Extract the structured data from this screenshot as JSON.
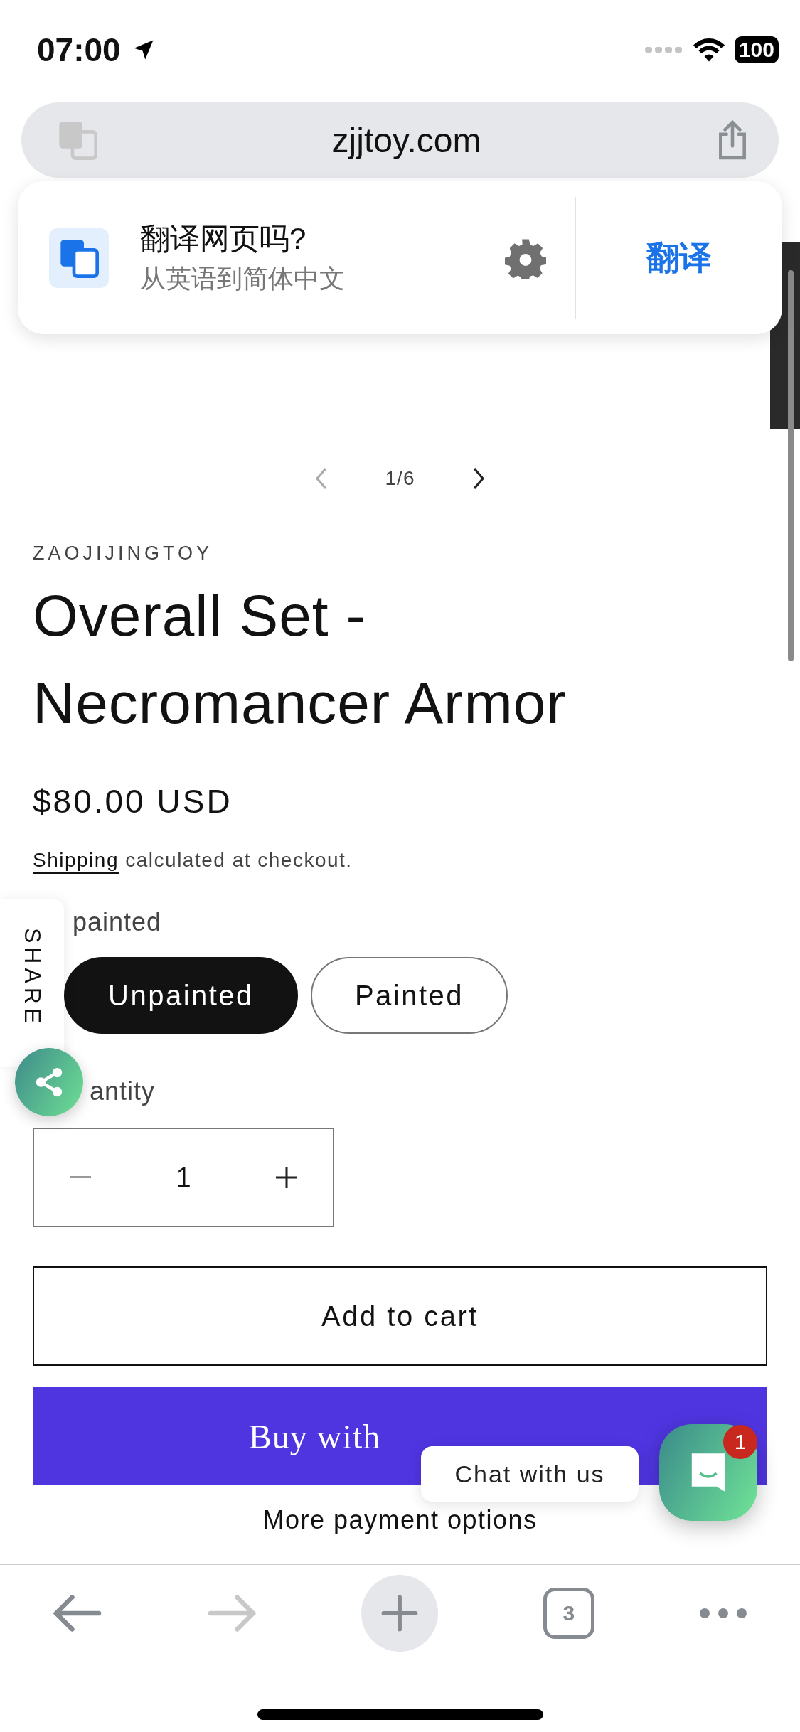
{
  "status_bar": {
    "time": "07:00",
    "battery": "100"
  },
  "address_bar": {
    "url": "zjjtoy.com"
  },
  "translate_prompt": {
    "title": "翻译网页吗?",
    "subtitle": "从英语到简体中文",
    "action": "翻译"
  },
  "gallery": {
    "counter": "1/6"
  },
  "product": {
    "vendor": "ZAOJIJINGTOY",
    "title": "Overall Set - Necromancer Armor",
    "price": "$80.00 USD",
    "shipping_link": "Shipping",
    "shipping_note": "calculated at checkout."
  },
  "variant": {
    "label": "painted",
    "options": [
      {
        "label": "Unpainted",
        "selected": true
      },
      {
        "label": "Painted",
        "selected": false
      }
    ]
  },
  "quantity": {
    "label": "antity",
    "value": "1"
  },
  "buttons": {
    "add_to_cart": "Add to cart",
    "buy_with": "Buy with",
    "more_payment": "More payment options"
  },
  "share_tab": {
    "label": "SHARE"
  },
  "chat": {
    "bubble": "Chat with us",
    "badge": "1"
  },
  "toolbar": {
    "tab_count": "3"
  }
}
